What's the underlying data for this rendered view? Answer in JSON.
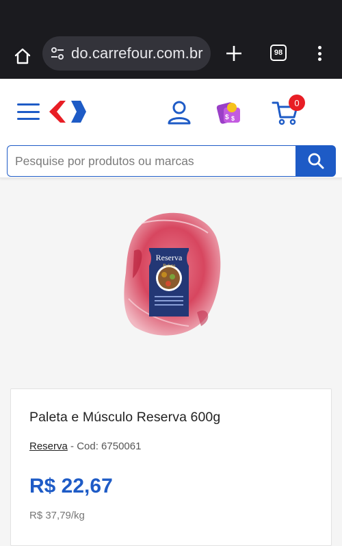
{
  "browser": {
    "url_text": "do.carrefour.com.br",
    "tab_count": "98"
  },
  "header": {
    "cart_count": "0",
    "search_placeholder": "Pesquise por produtos ou marcas"
  },
  "product": {
    "image_label_top": "Reserva",
    "image_label_script": "Paleta",
    "title": "Paleta e Músculo Reserva 600g",
    "brand": "Reserva",
    "code_text": "- Cod: 6750061",
    "price": "R$ 22,67",
    "unit_price": "R$ 37,79/kg"
  },
  "colors": {
    "brand_blue": "#1e5bc6",
    "brand_red": "#e81e25",
    "chrome_dark": "#1b1b1f"
  },
  "icons": [
    "home-icon",
    "site-settings-icon",
    "plus-icon",
    "tabs-icon",
    "more-vert-icon",
    "hamburger-icon",
    "carrefour-logo",
    "user-icon",
    "promo-icon",
    "cart-icon",
    "search-icon"
  ]
}
